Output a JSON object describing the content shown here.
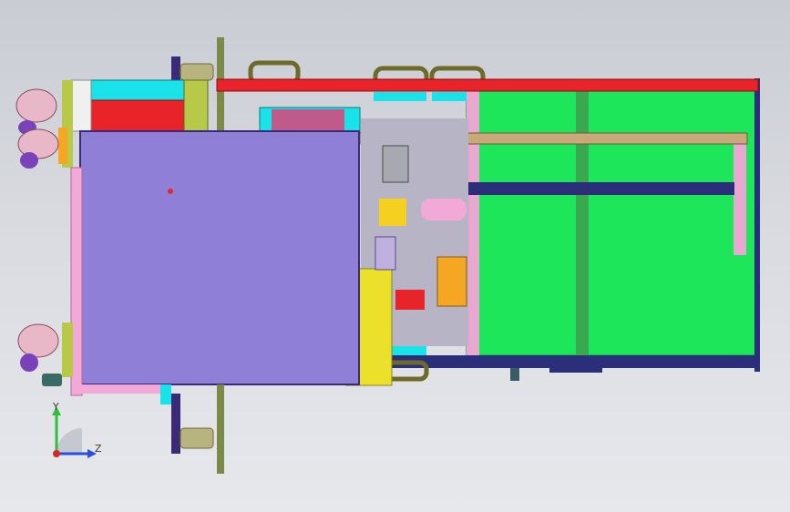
{
  "view": {
    "background_top": "#c9ccd3",
    "background_bottom": "#e7e8ec"
  },
  "colors": {
    "green_panel": "#1ee65a",
    "purple_plate": "#8f7fd6",
    "red_bar": "#e8232a",
    "cyan": "#19e3e8",
    "olive": "#b8c94a",
    "navy": "#2b2f7a",
    "yellow": "#ece12a",
    "orange": "#f5a623",
    "pink": "#f2a9d8"
  },
  "triad": {
    "y_label": "Y",
    "z_label": "Z",
    "y_color": "#2fbf3a",
    "z_color": "#2a4fe0",
    "origin_color": "#d6262a",
    "y_arrow_icon": "arrow-up-icon",
    "z_arrow_icon": "arrow-right-icon"
  }
}
